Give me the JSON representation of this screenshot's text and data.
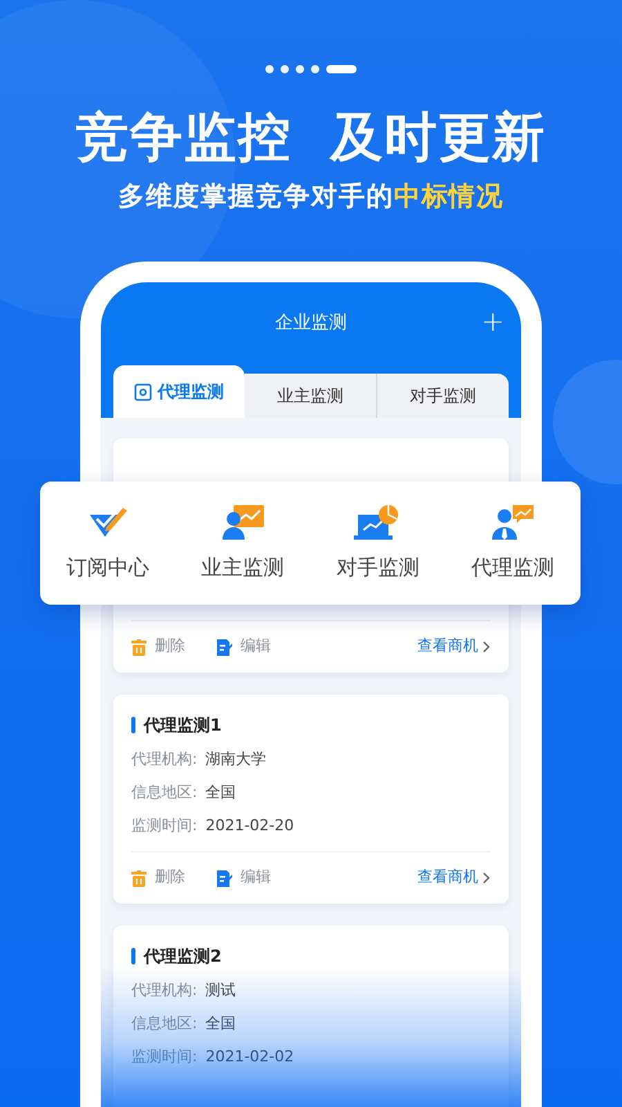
{
  "pager": [
    {
      "selected": false
    },
    {
      "selected": false
    },
    {
      "selected": false
    },
    {
      "selected": false
    },
    {
      "selected": true
    }
  ],
  "headline": "竞争监控  及时更新",
  "subtitle": {
    "text": "多维度掌握竞争对手的",
    "highlight": "中标情况"
  },
  "app": {
    "title": "企业监测",
    "add": "+",
    "tabs": [
      {
        "label": "代理监测",
        "selected": true
      },
      {
        "label": "业主监测",
        "selected": false
      },
      {
        "label": "对手监测",
        "selected": false
      }
    ],
    "cards": [
      {
        "actions": {
          "delete": "删除",
          "edit": "编辑",
          "view": "查看商机"
        }
      },
      {
        "title": "代理监测1",
        "fields": [
          {
            "label": "代理机构:",
            "value": "湖南大学"
          },
          {
            "label": "信息地区:",
            "value": "全国"
          },
          {
            "label": "监测时间:",
            "value": "2021-02-20"
          }
        ],
        "actions": {
          "delete": "删除",
          "edit": "编辑",
          "view": "查看商机"
        }
      },
      {
        "title": "代理监测2",
        "fields": [
          {
            "label": "代理机构:",
            "value": "测试"
          },
          {
            "label": "信息地区:",
            "value": "全国"
          },
          {
            "label": "监测时间:",
            "value": "2021-02-02"
          }
        ]
      }
    ]
  },
  "menu": [
    {
      "kind": "subscribe",
      "label": "订阅中心"
    },
    {
      "kind": "owner",
      "label": "业主监测"
    },
    {
      "kind": "rival",
      "label": "对手监测"
    },
    {
      "kind": "agent",
      "label": "代理监测"
    }
  ]
}
